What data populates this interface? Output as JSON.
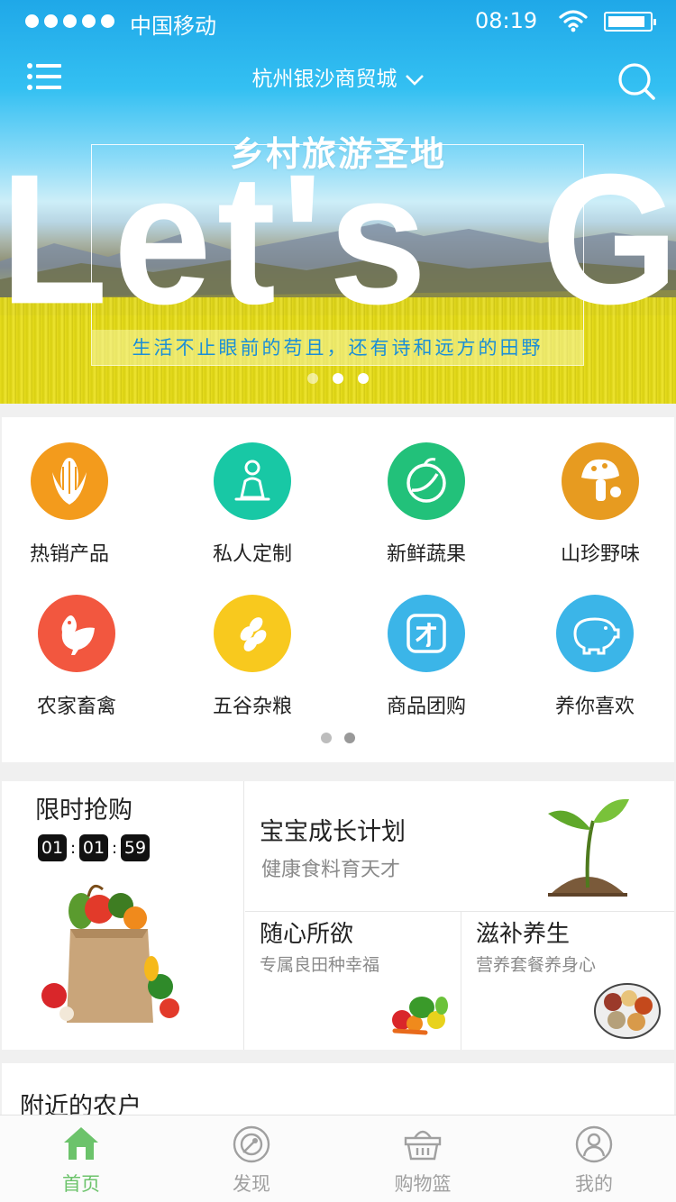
{
  "status_bar": {
    "carrier": "中国移动",
    "time": "08:19"
  },
  "header": {
    "location": "杭州银沙商贸城"
  },
  "banner": {
    "title": "乡村旅游圣地",
    "headline": "Let's  Go",
    "tagline": "生活不止眼前的苟且，还有诗和远方的田野",
    "page_count": 3,
    "active_index": 1
  },
  "categories": {
    "items": [
      {
        "label": "热销产品",
        "icon": "corn-icon",
        "color": "#f39b1c"
      },
      {
        "label": "私人定制",
        "icon": "person-icon",
        "color": "#18c8a5"
      },
      {
        "label": "新鲜蔬果",
        "icon": "fruit-icon",
        "color": "#22c17a"
      },
      {
        "label": "山珍野味",
        "icon": "mushroom-icon",
        "color": "#e79b20"
      },
      {
        "label": "农家畜禽",
        "icon": "chicken-icon",
        "color": "#f2573f"
      },
      {
        "label": "五谷杂粮",
        "icon": "grain-icon",
        "color": "#f8c91e"
      },
      {
        "label": "商品团购",
        "icon": "group-buy-icon",
        "color": "#3bb5e8"
      },
      {
        "label": "养你喜欢",
        "icon": "piggy-icon",
        "color": "#3bb5e8"
      }
    ],
    "page_count": 2,
    "active_index": 1
  },
  "promo": {
    "flash_sale": {
      "title": "限时抢购",
      "hours": "01",
      "minutes": "01",
      "seconds": "59"
    },
    "growth": {
      "title": "宝宝成长计划",
      "subtitle": "健康食料育天才"
    },
    "free": {
      "title": "随心所欲",
      "subtitle": "专属良田种幸福"
    },
    "nourish": {
      "title": "滋补养生",
      "subtitle": "营养套餐养身心"
    }
  },
  "nearby": {
    "title": "附近的农户"
  },
  "tabbar": {
    "tabs": [
      {
        "label": "首页",
        "icon": "home-icon",
        "active": true
      },
      {
        "label": "发现",
        "icon": "discover-icon",
        "active": false
      },
      {
        "label": "购物篮",
        "icon": "basket-icon",
        "active": false
      },
      {
        "label": "我的",
        "icon": "profile-icon",
        "active": false
      }
    ],
    "active_color": "#6cc36b",
    "inactive_color": "#a0a0a0"
  }
}
